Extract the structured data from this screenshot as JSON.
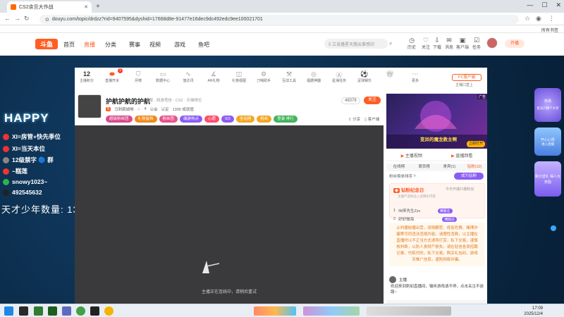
{
  "browser": {
    "tab_title": "CS2余旦大作战",
    "url": "douyu.com/topic/drdzz?rid=9407595&dyshid=17668d8e-91477e16dec9dc492edc9ee100021701",
    "bookmarks_label": "所有书签"
  },
  "site": {
    "logo": "斗鱼",
    "nav": [
      "首页",
      "直播",
      "分类",
      "赛事",
      "视频",
      "游戏",
      "鱼吧"
    ],
    "search_placeholder": "5 立该播星天猪出事感印",
    "user_icons": [
      "历史",
      "关注",
      "下载",
      "消息",
      "客户端",
      "任务"
    ],
    "open_button": "开播"
  },
  "overlay": {
    "happy": "HAPPY",
    "lines": [
      "XI=房管+快先季位",
      "XI=当天本位",
      "12级禁字 🔵 群",
      "~糕莲",
      "snowy1023~",
      "492545632"
    ],
    "talent": "天才少年数量: 13"
  },
  "toolbar": {
    "rank_num": "12",
    "items": [
      "主播积分",
      "直播开关",
      "月榜",
      "数据中心",
      "悠达讯",
      "AR礼物",
      "礼物视图",
      "刀哨助手",
      "互动工具",
      "福据神器",
      "星海任务",
      "足球娱乐",
      "更多"
    ],
    "pc_button": "PC客户端",
    "pc_sub": "主播口直上",
    "badge_count": "1"
  },
  "room": {
    "title": "护航护航的护航",
    "meta": "单服 · 网游竞技 · CS2 · 天梯排位",
    "level": "5",
    "category": "马刺羁城唯",
    "line2": [
      "4",
      "公会",
      "认定",
      "1300 成就值"
    ],
    "follow_count": "48378",
    "follow_label": "关注",
    "tags": [
      {
        "text": "超级粉丝团",
        "color": "#d94a8c"
      },
      {
        "text": "礼物留档",
        "color": "#f08a1c"
      },
      {
        "text": "粉丝团",
        "color": "#e8508e"
      },
      {
        "text": "端游热点",
        "color": "#8a5cf5"
      },
      {
        "text": "心愿",
        "color": "#ff4d6a"
      },
      {
        "text": "0/3",
        "color": "#8a5cf5"
      },
      {
        "text": "全站榜",
        "color": "#f5a623"
      },
      {
        "text": "粉丝",
        "color": "#f5a623"
      },
      {
        "text": "登录 排行",
        "color": "#42b35a"
      }
    ],
    "share": "分享",
    "client": "客户端"
  },
  "video": {
    "message": "主播正在连线中，请稍后重试"
  },
  "side": {
    "ad_label": "广告",
    "ad_title": "变异的魔龙教主啊",
    "ad_button": "立即打开",
    "tabs": [
      "主播视频",
      "直播回看"
    ],
    "sub_tabs": [
      "在线榜",
      "周贡榜",
      "贵宾(1)",
      "钻粉(32)"
    ],
    "fans_text": "粉丝榜单排序 ?",
    "fans_button": "成为钻粉",
    "badge_title": "钻粉纪念日",
    "badge_date": "今日开播21期粉丝",
    "badge_desc": "主播严选粉丝入选精彩内容",
    "users": [
      {
        "name": "IM来先生Zzc",
        "pill": "满版庄"
      },
      {
        "name": "好好微海",
        "pill": "满版庄"
      }
    ],
    "notice": "止判播始播出营，双侧翻官、低俗色情、赌博诈骗等可同违法违规内容。请理性消费，以主播在直播时以不正当方式诱导打赏，私下交易，谨慎核判断，以防人身财产损失。请在轻信各类招聘记事、代练代吹，私下交易，购买礼包码，游戏币推广信息，谨防网络诈骗。",
    "anchor": "主播",
    "welcome": "欢迎来到刺如直播间，输听游戏请不停，点击关注不迷路~"
  },
  "widgets": [
    "热场",
    "星光闪耀个大奖",
    "开心心愿",
    "进入直播",
    "累计送礼 得人大奖励"
  ],
  "taskbar": {
    "time": "17:09",
    "date": "2025/12/4"
  }
}
